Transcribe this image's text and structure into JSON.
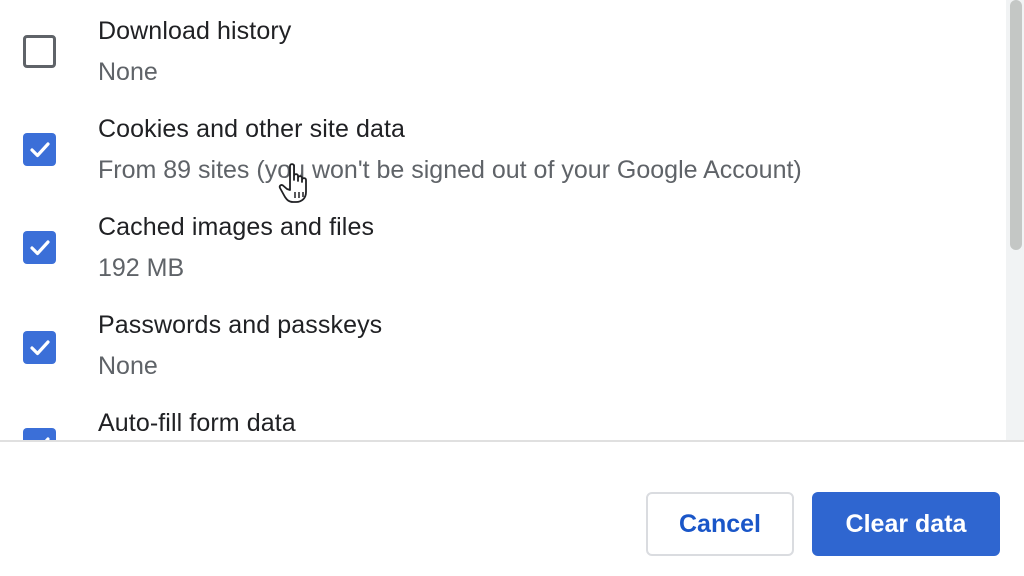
{
  "items": [
    {
      "title": "Download history",
      "subtitle": "None",
      "checked": false
    },
    {
      "title": "Cookies and other site data",
      "subtitle": "From 89 sites (you won't be signed out of your Google Account)",
      "checked": true
    },
    {
      "title": "Cached images and files",
      "subtitle": "192 MB",
      "checked": true
    },
    {
      "title": "Passwords and passkeys",
      "subtitle": "None",
      "checked": true
    },
    {
      "title": "Auto-fill form data",
      "subtitle": "",
      "checked": true
    }
  ],
  "buttons": {
    "cancel_label": "Cancel",
    "clear_label": "Clear data"
  },
  "colors": {
    "accent": "#2f66d0",
    "checkbox_checked": "#3b6fd8",
    "text_primary": "#202124",
    "text_secondary": "#5f6368"
  },
  "icons": {
    "cursor": "hand-pointer-icon",
    "check": "checkmark-icon"
  }
}
